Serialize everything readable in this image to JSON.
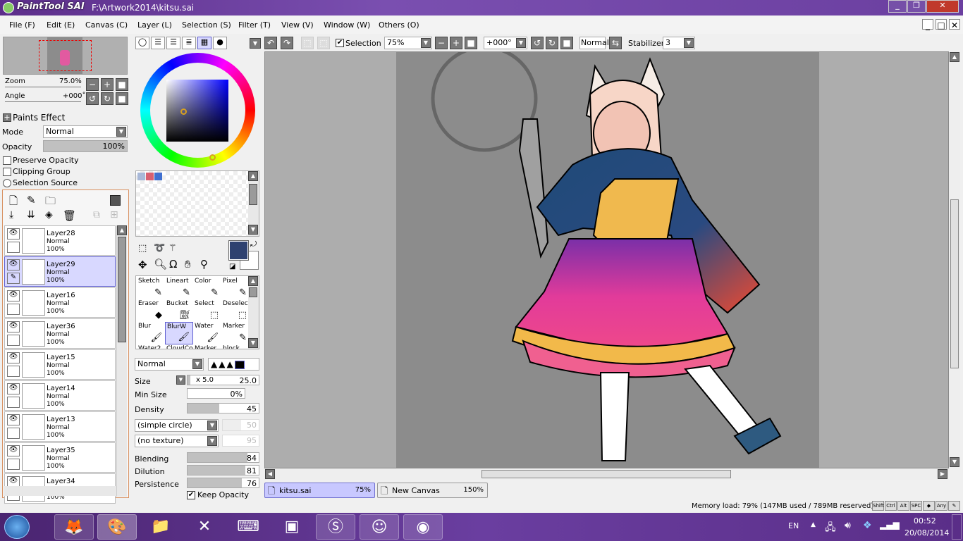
{
  "app": {
    "logo": "PaintTool SAI",
    "title": "F:\\Artwork2014\\kitsu.sai"
  },
  "menu": [
    "File (F)",
    "Edit (E)",
    "Canvas (C)",
    "Layer (L)",
    "Selection (S)",
    "Filter (T)",
    "View (V)",
    "Window (W)",
    "Others (O)"
  ],
  "navigator": {
    "zoom_label": "Zoom",
    "zoom_value": "75.0%",
    "angle_label": "Angle",
    "angle_value": "+000˚"
  },
  "layer_props": {
    "paints_effect": "Paints Effect",
    "mode_label": "Mode",
    "mode_value": "Normal",
    "opacity_label": "Opacity",
    "opacity_value": "100%",
    "opacity_pct": 100,
    "preserve_opacity": "Preserve Opacity",
    "clipping_group": "Clipping Group",
    "selection_source": "Selection Source"
  },
  "layers": [
    {
      "name": "Layer28",
      "mode": "Normal",
      "opacity": "100%",
      "selected": false
    },
    {
      "name": "Layer29",
      "mode": "Normal",
      "opacity": "100%",
      "selected": true
    },
    {
      "name": "Layer16",
      "mode": "Normal",
      "opacity": "100%",
      "selected": false
    },
    {
      "name": "Layer36",
      "mode": "Normal",
      "opacity": "100%",
      "selected": false
    },
    {
      "name": "Layer15",
      "mode": "Normal",
      "opacity": "100%",
      "selected": false
    },
    {
      "name": "Layer14",
      "mode": "Normal",
      "opacity": "100%",
      "selected": false
    },
    {
      "name": "Layer13",
      "mode": "Normal",
      "opacity": "100%",
      "selected": false
    },
    {
      "name": "Layer35",
      "mode": "Normal",
      "opacity": "100%",
      "selected": false
    },
    {
      "name": "Layer34",
      "mode": "Normal",
      "opacity": "100%",
      "selected": false
    }
  ],
  "colors": {
    "primary": "#2e4170",
    "secondary": "#ffffff",
    "swatches": [
      "#a8b8d8",
      "#d86070",
      "#4070d0"
    ]
  },
  "tools": [
    {
      "label": "Sketch",
      "icon": "pencil"
    },
    {
      "label": "Lineart",
      "icon": "pencil"
    },
    {
      "label": "Color",
      "icon": "pencil"
    },
    {
      "label": "Pixel",
      "icon": "pencil"
    },
    {
      "label": "Eraser",
      "icon": "eraser"
    },
    {
      "label": "Bucket",
      "icon": "bucket"
    },
    {
      "label": "Select",
      "icon": "select"
    },
    {
      "label": "Deselect",
      "icon": "deselect"
    },
    {
      "label": "Blur",
      "icon": "brush"
    },
    {
      "label": "BlurW",
      "icon": "brush"
    },
    {
      "label": "Water",
      "icon": "brush"
    },
    {
      "label": "Marker",
      "icon": "pencil"
    },
    {
      "label": "Water2",
      "icon": "brush"
    },
    {
      "label": "CloudCo",
      "icon": "brush"
    },
    {
      "label": "Marker",
      "icon": "pencil"
    },
    {
      "label": "block",
      "icon": "brush"
    }
  ],
  "brush": {
    "blend_mode": "Normal",
    "size_label": "Size",
    "size_mult": "x 5.0",
    "size_value": "25.0",
    "min_size_label": "Min Size",
    "min_size_value": "0%",
    "density_label": "Density",
    "density_value": "45",
    "shape": "(simple circle)",
    "shape_value": "50",
    "texture": "(no texture)",
    "texture_value": "95",
    "blending_label": "Blending",
    "blending_value": "84",
    "dilution_label": "Dilution",
    "dilution_value": "81",
    "persistence_label": "Persistence",
    "persistence_value": "76",
    "keep_opacity": "Keep Opacity"
  },
  "canvas_toolbar": {
    "selection_label": "Selection",
    "zoom": "75%",
    "angle": "+000°",
    "mode": "Normal",
    "stabilizer_label": "Stabilizer",
    "stabilizer_value": "3"
  },
  "doc_tabs": [
    {
      "name": "kitsu.sai",
      "zoom": "75%",
      "active": true
    },
    {
      "name": "New Canvas",
      "zoom": "150%",
      "active": false
    }
  ],
  "status": {
    "memory": "Memory load: 79% (147MB used / 789MB reserved)",
    "keys": [
      "Shift",
      "Ctrl",
      "Alt",
      "SPC",
      "◆",
      "Any",
      "✎"
    ]
  },
  "taskbar": {
    "lang": "EN",
    "time": "00:52",
    "date": "20/08/2014"
  }
}
